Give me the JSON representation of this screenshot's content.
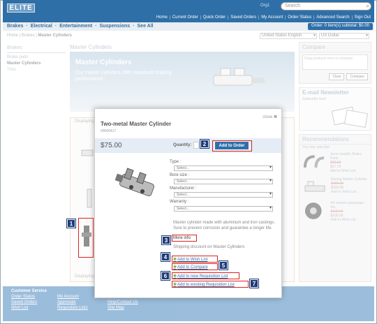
{
  "header": {
    "logo": "ELITE",
    "org": "Org1",
    "search_placeholder": "Search",
    "nav": [
      "Home",
      "Current Order",
      "Quick Order",
      "Saved Orders",
      "My Account",
      "Order Status",
      "Advanced Search",
      "Sign Out"
    ]
  },
  "categories": [
    "Brakes",
    "Electrical",
    "Entertainment",
    "Suspensions",
    "See All"
  ],
  "order_summary": "Order: 0 item(s) subtotal: $0.00",
  "breadcrumb": {
    "home": "Home",
    "sep1": "|",
    "cat": "Brakes",
    "sep2": "|",
    "current": "Master Cylinders"
  },
  "locale": {
    "language": "United States English",
    "currency": "US Dollar"
  },
  "left_nav": {
    "heading": "Brakes",
    "items": [
      "Brake pads",
      "Master Cylinders",
      "Tires"
    ]
  },
  "main": {
    "title": "Master Cylinders",
    "banner_title": "Master Cylinders",
    "banner_text": "Our master cylinders offer maximum braking performance.",
    "displaying_top": "Displaying",
    "displaying_bottom": "Displaying"
  },
  "compare": {
    "heading": "Compare",
    "dropzone": "Drag products here to compare",
    "clear": "Clear",
    "compare": "Compare"
  },
  "newsletter": {
    "heading": "E-mail Newsletter",
    "sub": "Subscribe now!"
  },
  "recommendations": {
    "heading": "Recommendations",
    "sub": "You may also like:",
    "items": [
      {
        "name": "Semi-metallic Brake Pads",
        "old": "$29.99",
        "price": "$17.75",
        "cta": "Add to Wish List"
      },
      {
        "name": "Racing Master Cylinder",
        "old": "$289.99",
        "price": "$199.00",
        "cta": "Add to Wish List"
      },
      {
        "name": "All season passenger tire",
        "old": "$139.99",
        "price": "$100.00",
        "cta": "Add to Wish List"
      }
    ]
  },
  "footer": {
    "col1": {
      "heading": "Customer Service",
      "links": [
        "Order Status",
        "Saved Orders",
        "Wish List"
      ]
    },
    "col2": {
      "links": [
        "My Account",
        "Approvals",
        "Requisition Lists"
      ]
    },
    "col3": {
      "links": [
        "Help/Contact Us",
        "Site Map"
      ]
    }
  },
  "quickview": {
    "close": "close",
    "title": "Two-metal Master Cylinder",
    "sku": "#0000417",
    "price": "$75.00",
    "quantity_label": "Quantity:",
    "add_to_order": "Add to Order",
    "attributes": [
      {
        "label": "Type :",
        "value": "Select..."
      },
      {
        "label": "Bore size :",
        "value": "Select..."
      },
      {
        "label": "Manufacturer :",
        "value": "Select..."
      },
      {
        "label": "Warranty :",
        "value": "Select..."
      }
    ],
    "description": "Master cylinder made with aluminum and iron castings. Sure to prevent corrosion and guarantee a longer life.",
    "more_info": "More info",
    "shipping": "Shipping discount on Master Cylinders",
    "add_wishlist": "Add to Wish List",
    "add_compare": "Add to Compare",
    "add_new_req": "Add to new Requisition List",
    "add_existing_req": "Add to existing Requisition List"
  },
  "callouts": [
    "1",
    "2",
    "3",
    "4",
    "5",
    "6",
    "7"
  ],
  "colors": {
    "brand": "#2f6fa8",
    "callout": "#1d3b78",
    "highlight": "#d22222"
  }
}
